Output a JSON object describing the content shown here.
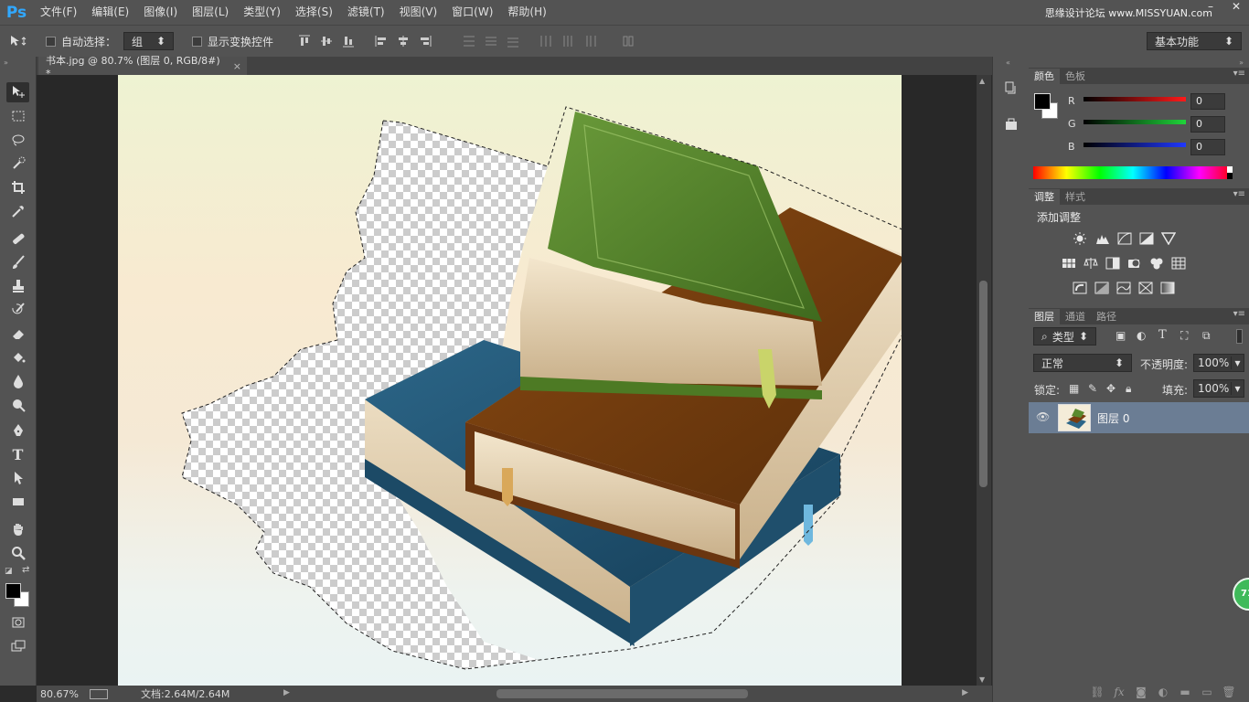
{
  "app": {
    "logo": "Ps"
  },
  "menu": [
    "文件(F)",
    "编辑(E)",
    "图像(I)",
    "图层(L)",
    "类型(Y)",
    "选择(S)",
    "滤镜(T)",
    "视图(V)",
    "窗口(W)",
    "帮助(H)"
  ],
  "watermark": "思缘设计论坛 www.MISSYUAN.com",
  "options": {
    "auto_select_label": "自动选择：",
    "auto_select_value": "组",
    "show_transform_label": "显示变换控件",
    "workspace": "基本功能"
  },
  "document": {
    "tab_title": "书本.jpg @ 80.7% (图层 0, RGB/8#) *"
  },
  "status": {
    "zoom": "80.67%",
    "doc_info": "文档:2.64M/2.64M"
  },
  "color_panel": {
    "tabs": [
      "颜色",
      "色板"
    ],
    "channels": [
      {
        "label": "R",
        "value": "0",
        "color": "#ff2020"
      },
      {
        "label": "G",
        "value": "0",
        "color": "#20d040"
      },
      {
        "label": "B",
        "value": "0",
        "color": "#2040ff"
      }
    ]
  },
  "adjust_panel": {
    "tabs": [
      "调整",
      "样式"
    ],
    "title": "添加调整"
  },
  "layers_panel": {
    "tabs": [
      "图层",
      "通道",
      "路径"
    ],
    "filter_kind": "类型",
    "blend_mode": "正常",
    "opacity_label": "不透明度:",
    "opacity": "100%",
    "lock_label": "锁定:",
    "fill_label": "填充:",
    "fill": "100%",
    "layers": [
      {
        "name": "图层 0",
        "visible": true
      }
    ]
  },
  "badge": "71",
  "colors": {
    "accent": "#31a8ff",
    "layer_selected": "#6b7d94"
  }
}
